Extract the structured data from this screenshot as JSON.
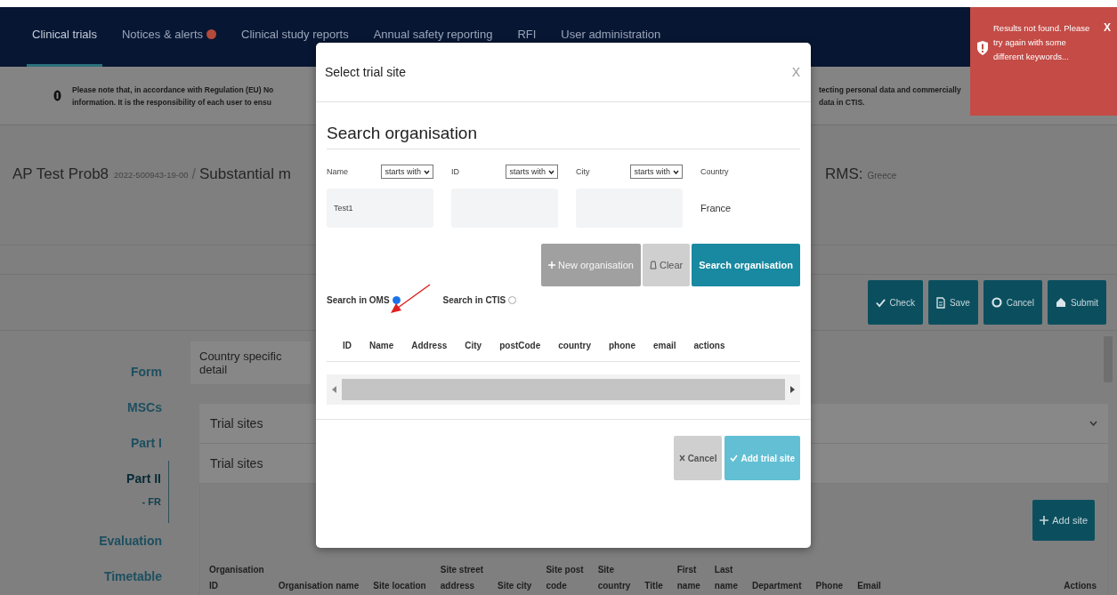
{
  "nav": {
    "tabs": [
      {
        "label": "Clinical trials",
        "selected": true,
        "badge": false
      },
      {
        "label": "Notices & alerts",
        "selected": false,
        "badge": true
      },
      {
        "label": "Clinical study reports",
        "selected": false,
        "badge": false
      },
      {
        "label": "Annual safety reporting",
        "selected": false,
        "badge": false
      },
      {
        "label": "RFI",
        "selected": false,
        "badge": false
      },
      {
        "label": "User administration",
        "selected": false,
        "badge": false
      }
    ]
  },
  "notice": {
    "left_lines": [
      "Please note that, in accordance with Regulation (EU) No",
      "information. It is the responsibility of each user to ensu"
    ],
    "right_lines": [
      "tecting personal data and commercially",
      "data in CTIS."
    ]
  },
  "header": {
    "title": "AP Test Prob8",
    "trial_number": "2022-500943-19-00",
    "separator": "/",
    "subtitle": "Substantial m",
    "rms_label": "RMS:",
    "rms_value": "Greece"
  },
  "toolbar": {
    "buttons": [
      {
        "label": "Check",
        "kind": "check"
      },
      {
        "label": "Save",
        "kind": "save"
      },
      {
        "label": "Cancel",
        "kind": "cancel"
      },
      {
        "label": "Submit",
        "kind": "submit"
      }
    ]
  },
  "side_nav": {
    "items": [
      {
        "label": "Form",
        "selected": false
      },
      {
        "label": "MSCs",
        "selected": false
      },
      {
        "label": "Part I",
        "selected": false
      },
      {
        "label": "Part II",
        "selected": true,
        "children": [
          {
            "label": "- FR"
          }
        ]
      },
      {
        "label": "Evaluation",
        "selected": false
      },
      {
        "label": "Timetable",
        "selected": false
      }
    ]
  },
  "content": {
    "country_panel": "Country specific detail",
    "sections": [
      {
        "title": "Trial sites",
        "expandable": true
      },
      {
        "title": "Trial sites",
        "expandable": false
      }
    ],
    "add_site_button": "Add site",
    "table": {
      "columns": [
        [
          "Organisation",
          "ID"
        ],
        [
          "Organisation name"
        ],
        [
          "Site location"
        ],
        [
          "Site street",
          "address"
        ],
        [
          "Site city"
        ],
        [
          "Site post",
          "code"
        ],
        [
          "Site",
          "country"
        ],
        [
          "Title"
        ],
        [
          "First",
          "name"
        ],
        [
          "Last",
          "name"
        ],
        [
          "Department"
        ],
        [
          "Phone"
        ],
        [
          "Email"
        ],
        [
          "Actions"
        ]
      ]
    }
  },
  "modal": {
    "title": "Select trial site",
    "close": "X",
    "section_title": "Search organisation",
    "filters": [
      {
        "label": "Name",
        "operator": "starts with",
        "value": "Test1"
      },
      {
        "label": "ID",
        "operator": "starts with"
      },
      {
        "label": "City",
        "operator": "starts with"
      }
    ],
    "country": {
      "label": "Country",
      "value": "France"
    },
    "buttons": [
      {
        "label": "New organisation",
        "kind": "new",
        "disabled": true
      },
      {
        "label": "Clear",
        "kind": "clear",
        "disabled": false
      },
      {
        "label": "Search organisation",
        "kind": "search",
        "disabled": false
      }
    ],
    "sources": [
      {
        "label": "Search in OMS",
        "selected": true
      },
      {
        "label": "Search in CTIS",
        "selected": false
      }
    ],
    "results": {
      "columns": [
        "ID",
        "Name",
        "Address",
        "City",
        "postCode",
        "country",
        "phone",
        "email",
        "actions"
      ]
    },
    "footer_buttons": [
      {
        "label": "Cancel",
        "kind": "cancel",
        "disabled": false
      },
      {
        "label": "Add trial site",
        "kind": "add",
        "disabled": true
      }
    ]
  },
  "toast": {
    "message": "Results not found. Please try again with some different keywords...",
    "close": "X"
  }
}
